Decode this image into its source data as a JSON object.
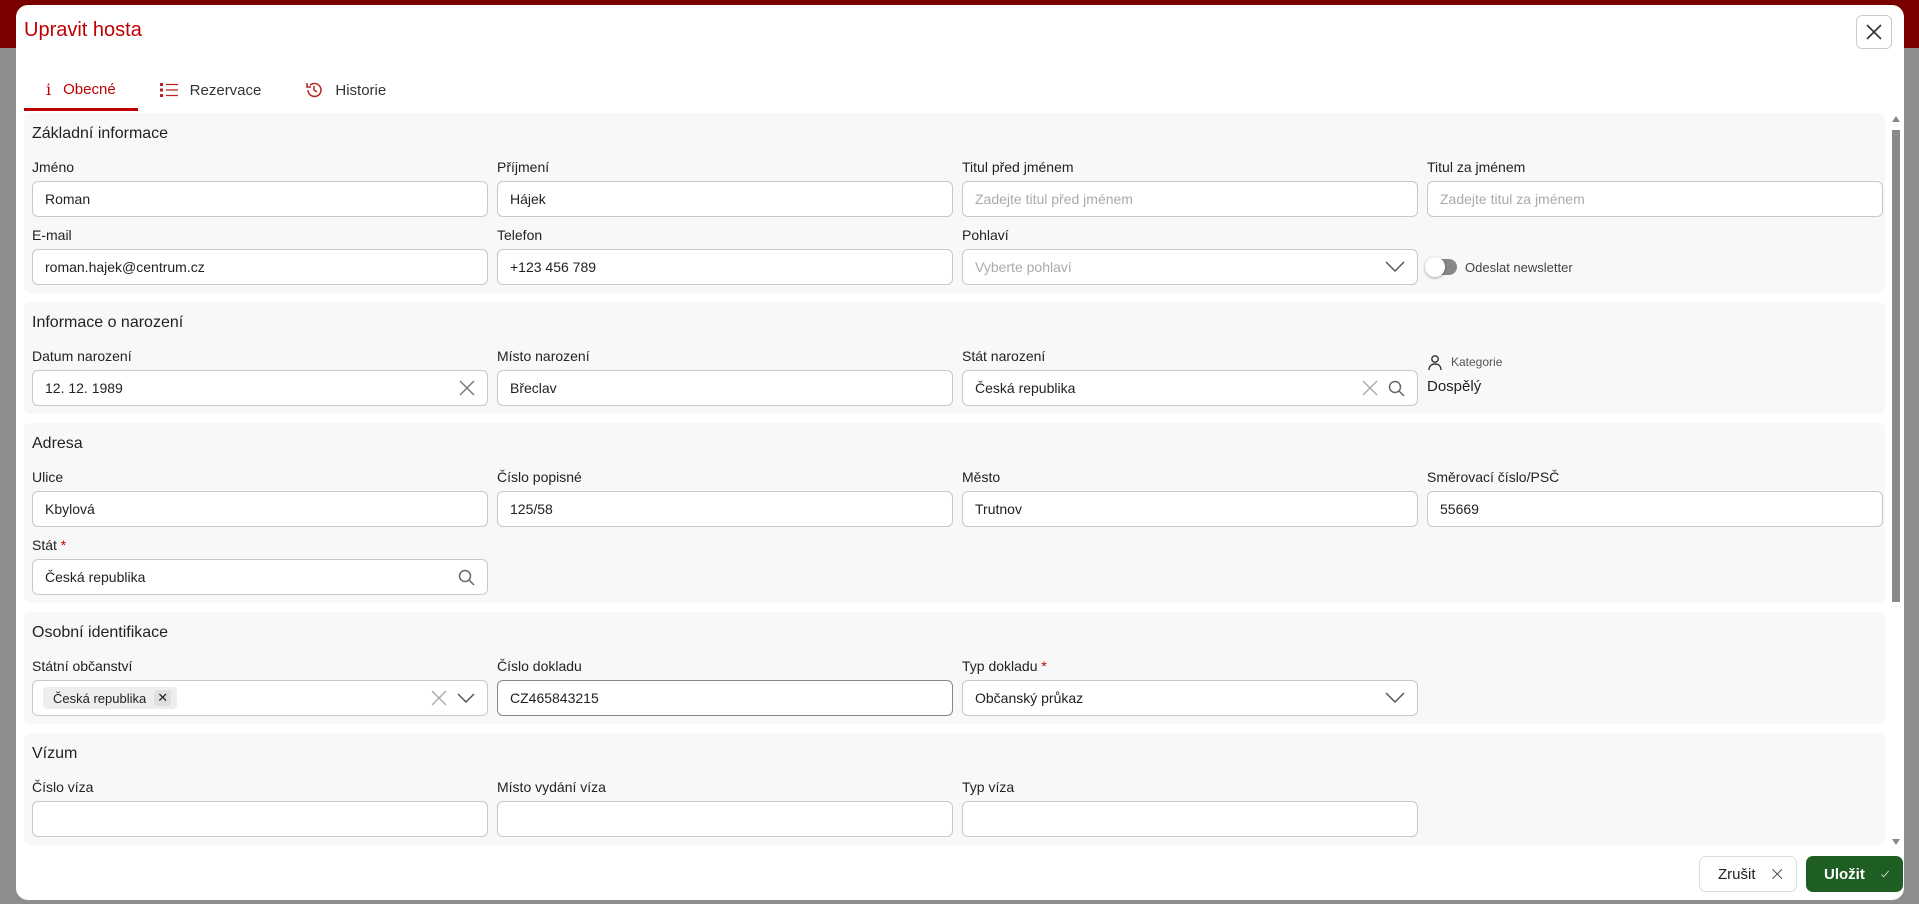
{
  "dialog": {
    "title": "Upravit hosta"
  },
  "tabs": [
    {
      "label": "Obecné",
      "icon": "info-icon"
    },
    {
      "label": "Rezervace",
      "icon": "list-icon"
    },
    {
      "label": "Historie",
      "icon": "history-icon"
    }
  ],
  "sections": {
    "basic": {
      "title": "Základní informace",
      "first_name": {
        "label": "Jméno",
        "value": "Roman"
      },
      "last_name": {
        "label": "Příjmení",
        "value": "Hájek"
      },
      "title_before": {
        "label": "Titul před jménem",
        "placeholder": "Zadejte titul před jménem"
      },
      "title_after": {
        "label": "Titul za jménem",
        "placeholder": "Zadejte titul za jménem"
      },
      "email": {
        "label": "E-mail",
        "value": "roman.hajek@centrum.cz"
      },
      "phone": {
        "label": "Telefon",
        "value": "+123 456 789"
      },
      "gender": {
        "label": "Pohlaví",
        "placeholder": "Vyberte pohlaví"
      },
      "newsletter": {
        "label": "Odeslat newsletter",
        "on": false
      }
    },
    "birth": {
      "title": "Informace o narození",
      "date": {
        "label": "Datum narození",
        "value": "12. 12. 1989"
      },
      "place": {
        "label": "Místo narození",
        "value": "Břeclav"
      },
      "country": {
        "label": "Stát narození",
        "value": "Česká republika"
      },
      "category": {
        "label": "Kategorie",
        "value": "Dospělý"
      }
    },
    "address": {
      "title": "Adresa",
      "street": {
        "label": "Ulice",
        "value": "Kbylová"
      },
      "number": {
        "label": "Číslo popisné",
        "value": "125/58"
      },
      "city": {
        "label": "Město",
        "value": "Trutnov"
      },
      "zip": {
        "label": "Směrovací číslo/PSČ",
        "value": "55669"
      },
      "state": {
        "label": "Stát",
        "required": "*",
        "value": "Česká republika"
      }
    },
    "identity": {
      "title": "Osobní identifikace",
      "citizenship": {
        "label": "Státní občanství",
        "chips": [
          "Česká republika"
        ]
      },
      "doc_number": {
        "label": "Číslo dokladu",
        "value": "CZ465843215"
      },
      "doc_type": {
        "label": "Typ dokladu",
        "required": "*",
        "value": "Občanský průkaz"
      }
    },
    "visa": {
      "title": "Vízum",
      "number": {
        "label": "Číslo víza"
      },
      "place": {
        "label": "Místo vydání víza"
      },
      "type": {
        "label": "Typ víza"
      }
    }
  },
  "footer": {
    "cancel": "Zrušit",
    "save": "Uložit"
  },
  "colors": {
    "accent": "#c00000",
    "save": "#1e5e23"
  }
}
